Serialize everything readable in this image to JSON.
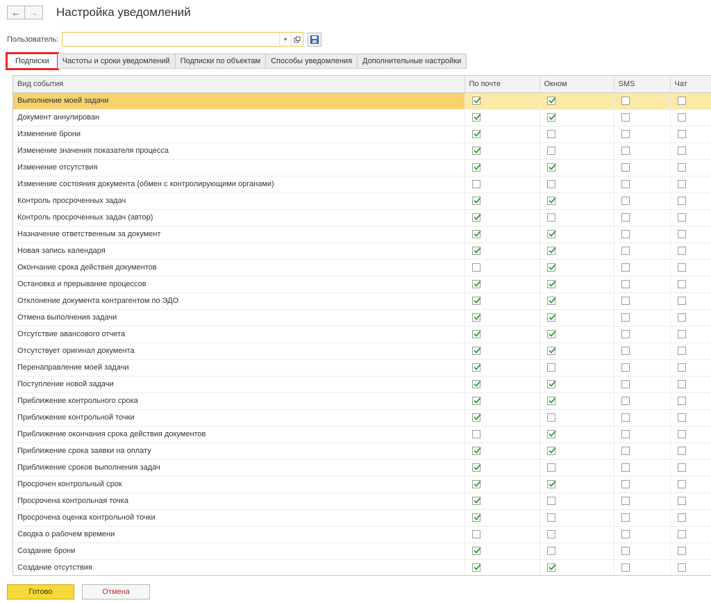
{
  "window": {
    "title": "Настройка уведомлений"
  },
  "nav": {
    "back_icon": "arrow-left-icon",
    "forward_icon": "arrow-right-icon"
  },
  "user": {
    "label": "Пользователь:",
    "value": "",
    "placeholder": ""
  },
  "tabs": [
    {
      "label": "Подписки",
      "active": true
    },
    {
      "label": "Частоты и сроки уведомлений",
      "active": false
    },
    {
      "label": "Подписки по объектам",
      "active": false
    },
    {
      "label": "Способы уведомления",
      "active": false
    },
    {
      "label": "Дополнительные настройки",
      "active": false
    }
  ],
  "table": {
    "headers": {
      "event": "Вид события",
      "email": "По почте",
      "window": "Окном",
      "sms": "SMS",
      "chat": "Чат"
    },
    "rows": [
      {
        "event": "Выполнение моей задачи",
        "email": true,
        "window": true,
        "sms": false,
        "chat": false
      },
      {
        "event": "Документ аннулирован",
        "email": true,
        "window": true,
        "sms": false,
        "chat": false
      },
      {
        "event": "Изменение брони",
        "email": true,
        "window": false,
        "sms": false,
        "chat": false
      },
      {
        "event": "Изменение значения показателя процесса",
        "email": true,
        "window": false,
        "sms": false,
        "chat": false
      },
      {
        "event": "Изменение отсутствия",
        "email": true,
        "window": true,
        "sms": false,
        "chat": false
      },
      {
        "event": "Изменение состояния документа (обмен с контролирующими органами)",
        "email": false,
        "window": false,
        "sms": false,
        "chat": false
      },
      {
        "event": "Контроль просроченных задач",
        "email": true,
        "window": true,
        "sms": false,
        "chat": false
      },
      {
        "event": "Контроль просроченных задач (автор)",
        "email": true,
        "window": false,
        "sms": false,
        "chat": false
      },
      {
        "event": "Назначение ответственным за документ",
        "email": true,
        "window": true,
        "sms": false,
        "chat": false
      },
      {
        "event": "Новая запись календаря",
        "email": true,
        "window": true,
        "sms": false,
        "chat": false
      },
      {
        "event": "Окончание срока действия документов",
        "email": false,
        "window": true,
        "sms": false,
        "chat": false
      },
      {
        "event": "Остановка и прерывание процессов",
        "email": true,
        "window": true,
        "sms": false,
        "chat": false
      },
      {
        "event": "Отклонение документа контрагентом по ЭДО",
        "email": true,
        "window": true,
        "sms": false,
        "chat": false
      },
      {
        "event": "Отмена выполнения задачи",
        "email": true,
        "window": true,
        "sms": false,
        "chat": false
      },
      {
        "event": "Отсутствие авансового отчета",
        "email": true,
        "window": true,
        "sms": false,
        "chat": false
      },
      {
        "event": "Отсутствует оригинал документа",
        "email": true,
        "window": true,
        "sms": false,
        "chat": false
      },
      {
        "event": "Перенаправление моей задачи",
        "email": true,
        "window": false,
        "sms": false,
        "chat": false
      },
      {
        "event": "Поступление новой задачи",
        "email": true,
        "window": true,
        "sms": false,
        "chat": false
      },
      {
        "event": "Приближение контрольного срока",
        "email": true,
        "window": true,
        "sms": false,
        "chat": false
      },
      {
        "event": "Приближение контрольной точки",
        "email": true,
        "window": false,
        "sms": false,
        "chat": false
      },
      {
        "event": "Приближение окончания срока действия документов",
        "email": false,
        "window": true,
        "sms": false,
        "chat": false
      },
      {
        "event": "Приближение срока заявки на оплату",
        "email": true,
        "window": true,
        "sms": false,
        "chat": false
      },
      {
        "event": "Приближение сроков выполнения задач",
        "email": true,
        "window": false,
        "sms": false,
        "chat": false
      },
      {
        "event": "Просрочен контрольный срок",
        "email": true,
        "window": true,
        "sms": false,
        "chat": false
      },
      {
        "event": "Просрочена контрольная точка",
        "email": true,
        "window": false,
        "sms": false,
        "chat": false
      },
      {
        "event": "Просрочена оценка контрольной точки",
        "email": true,
        "window": false,
        "sms": false,
        "chat": false
      },
      {
        "event": "Сводка о рабочем времени",
        "email": false,
        "window": false,
        "sms": false,
        "chat": false
      },
      {
        "event": "Создание брони",
        "email": true,
        "window": false,
        "sms": false,
        "chat": false
      },
      {
        "event": "Создание отсутствия",
        "email": true,
        "window": true,
        "sms": false,
        "chat": false
      }
    ],
    "selected_row": 0
  },
  "footer": {
    "done_label": "Готово",
    "cancel_label": "Отмена"
  },
  "colors": {
    "accent_yellow": "#f5d93a",
    "selected_row": "#fbeaa6",
    "check_green": "#3a9a3a",
    "tab_highlight": "#e8252b",
    "cancel_text": "#c0282d"
  }
}
